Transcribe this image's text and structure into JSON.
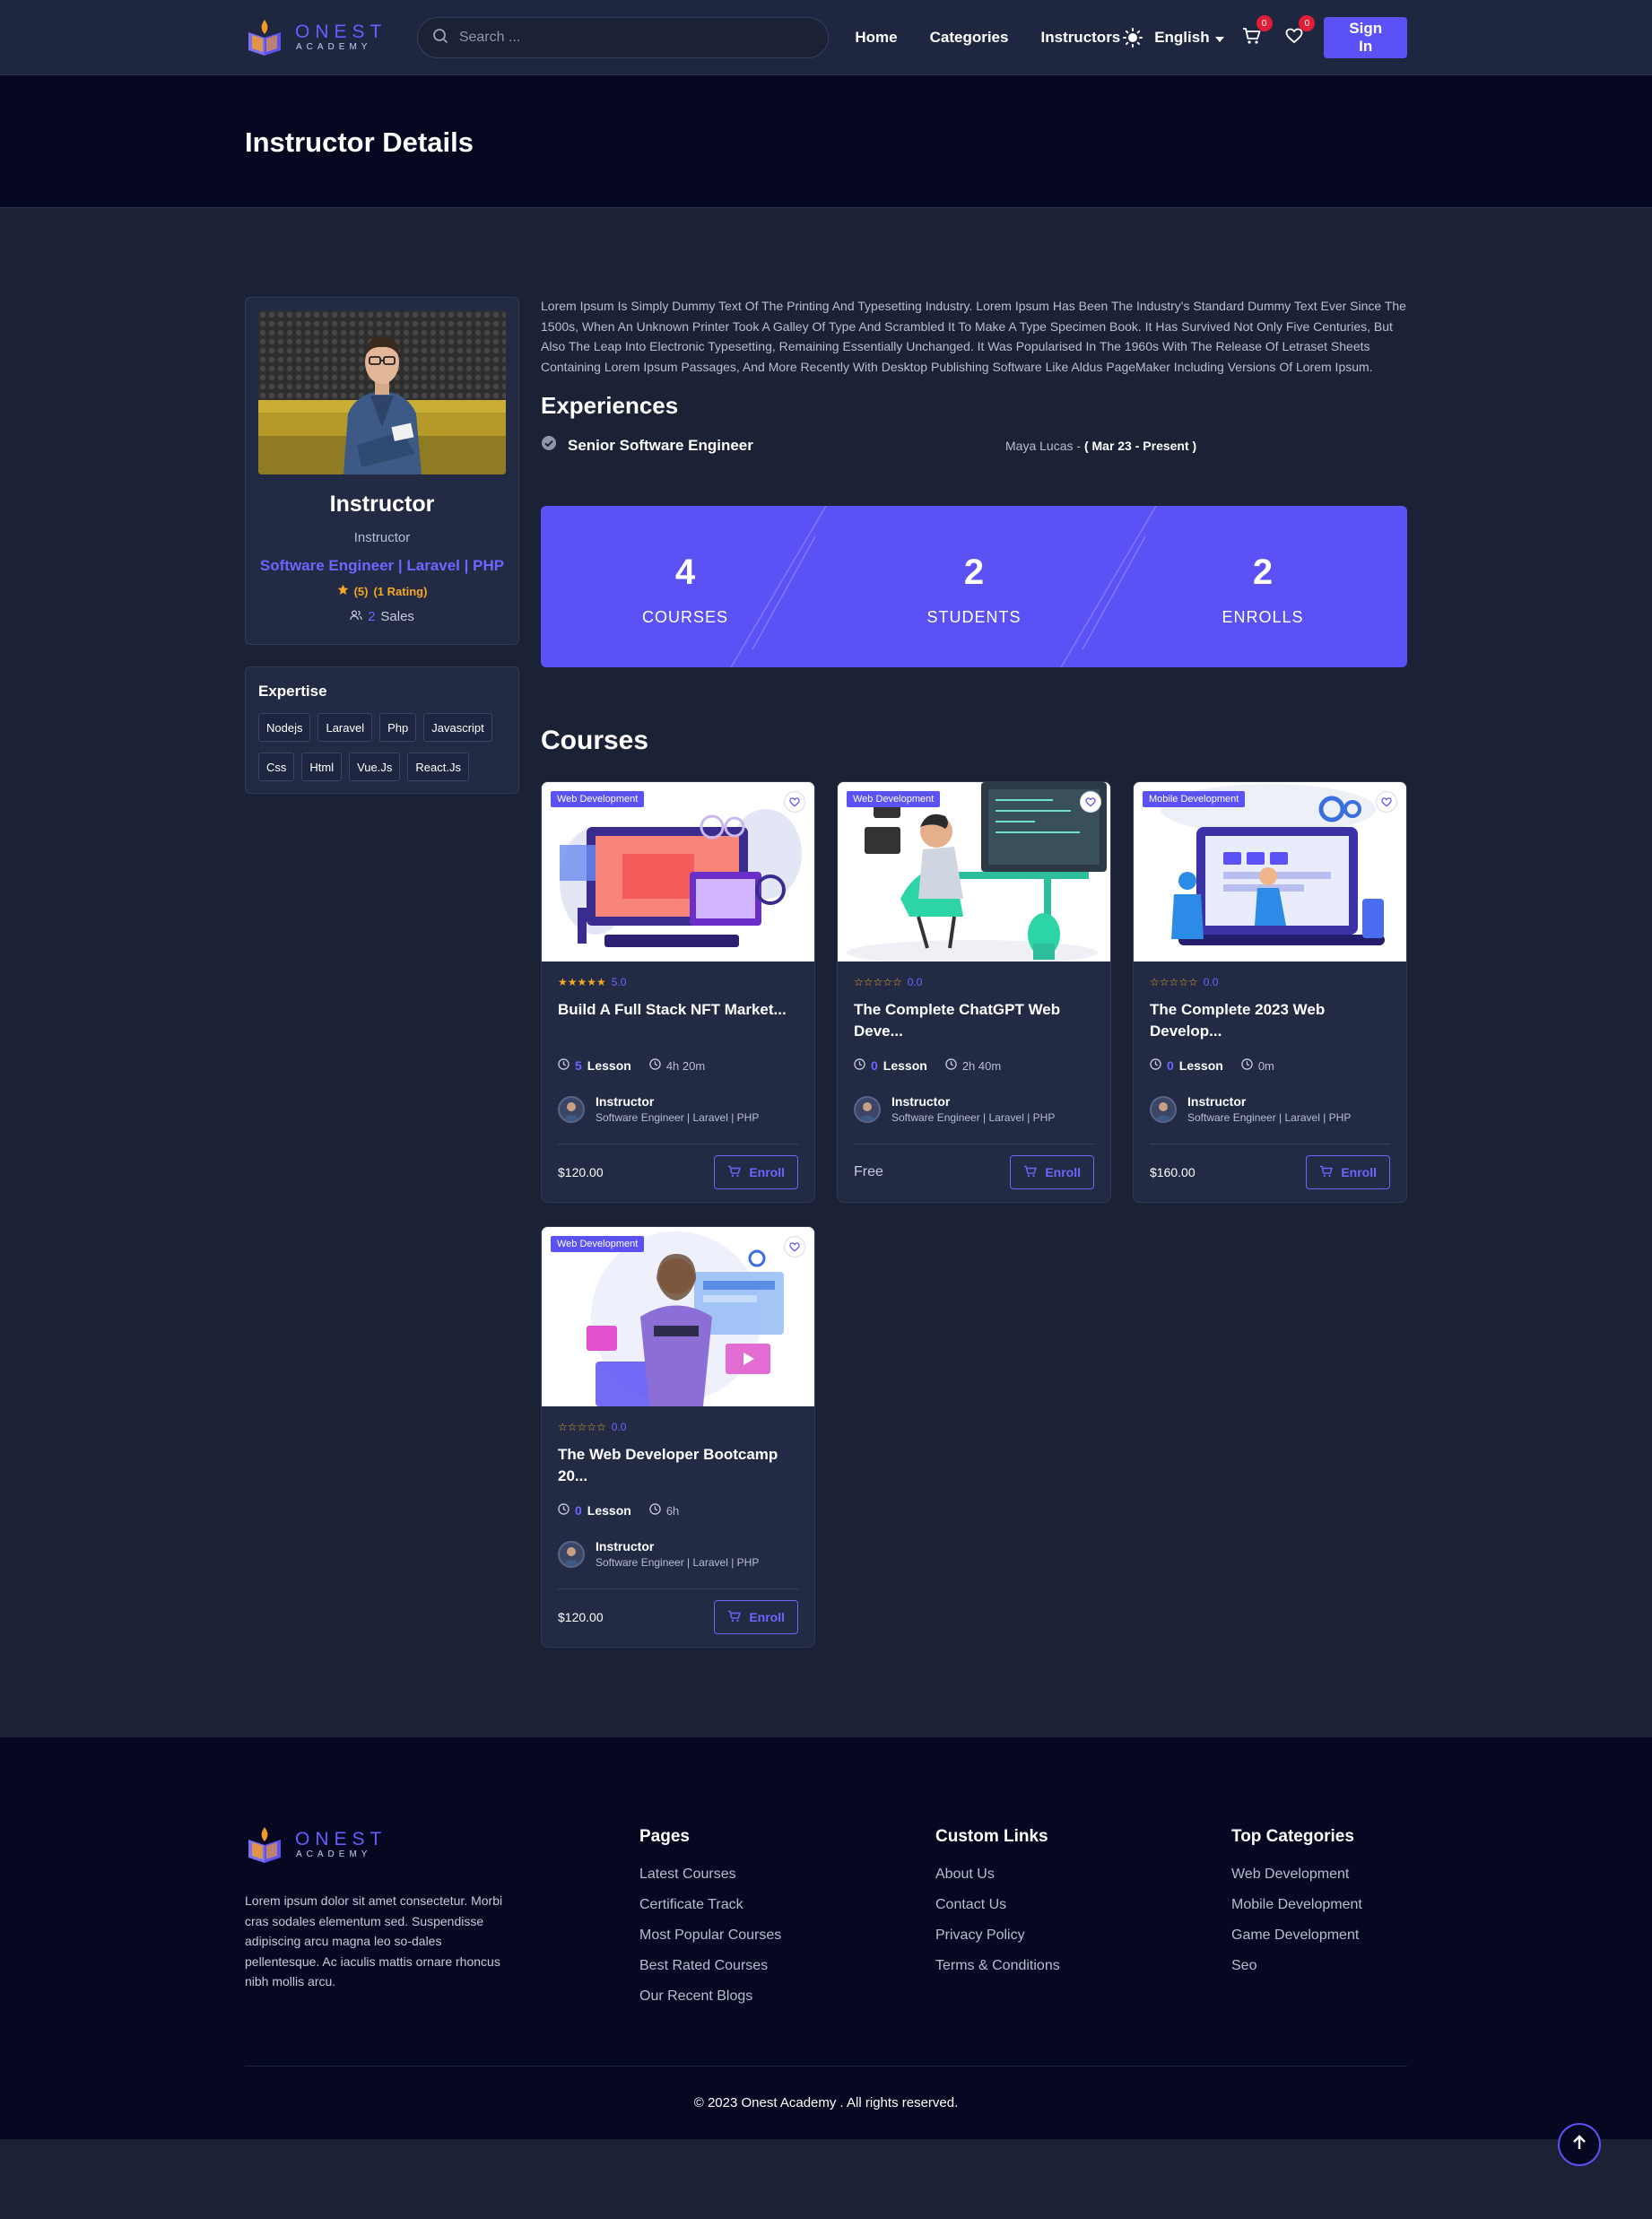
{
  "brand": {
    "name": "ONEST",
    "sub": "ACADEMY"
  },
  "header": {
    "search_placeholder": "Search ...",
    "nav": [
      "Home",
      "Categories",
      "Instructors"
    ],
    "language": "English",
    "cart_count": "0",
    "wishlist_count": "0",
    "sign_in": "Sign In"
  },
  "banner": {
    "title": "Instructor Details"
  },
  "profile": {
    "name": "Instructor",
    "role": "Instructor",
    "specialty": "Software Engineer | Laravel | PHP",
    "rating": "(5)",
    "rating_count": "(1 Rating)",
    "sales_count": "2",
    "sales_label": "Sales"
  },
  "expertise": {
    "title": "Expertise",
    "tags": [
      "Nodejs",
      "Laravel",
      "Php",
      "Javascript",
      "Css",
      "Html",
      "Vue.Js",
      "React.Js"
    ]
  },
  "bio": "Lorem Ipsum Is Simply Dummy Text Of The Printing And Typesetting Industry. Lorem Ipsum Has Been The Industry's Standard Dummy Text Ever Since The 1500s, When An Unknown Printer Took A Galley Of Type And Scrambled It To Make A Type Specimen Book. It Has Survived Not Only Five Centuries, But Also The Leap Into Electronic Typesetting, Remaining Essentially Unchanged. It Was Popularised In The 1960s With The Release Of Letraset Sheets Containing Lorem Ipsum Passages, And More Recently With Desktop Publishing Software Like Aldus PageMaker Including Versions Of Lorem Ipsum.",
  "experiences": {
    "title": "Experiences",
    "items": [
      {
        "title": "Senior Software Engineer",
        "company": "Maya Lucas - ",
        "period": "( Mar 23 - Present )"
      }
    ]
  },
  "stats": [
    {
      "value": "4",
      "label": "COURSES"
    },
    {
      "value": "2",
      "label": "STUDENTS"
    },
    {
      "value": "2",
      "label": "ENROLLS"
    }
  ],
  "courses": {
    "title": "Courses",
    "items": [
      {
        "category": "Web Development",
        "rating": "5.0",
        "stars": 5,
        "title": "Build A Full Stack NFT Market...",
        "lessons": "5",
        "lesson_label": "Lesson",
        "duration": "4h 20m",
        "instructor": "Instructor",
        "instructor_spec": "Software Engineer | Laravel | PHP",
        "price": "$120.00",
        "enroll": "Enroll"
      },
      {
        "category": "Web Development",
        "rating": "0.0",
        "stars": 0,
        "title": "The Complete ChatGPT Web Deve...",
        "lessons": "0",
        "lesson_label": "Lesson",
        "duration": "2h 40m",
        "instructor": "Instructor",
        "instructor_spec": "Software Engineer | Laravel | PHP",
        "price": "Free",
        "enroll": "Enroll"
      },
      {
        "category": "Mobile Development",
        "rating": "0.0",
        "stars": 0,
        "title": "The Complete 2023 Web Develop...",
        "lessons": "0",
        "lesson_label": "Lesson",
        "duration": "0m",
        "instructor": "Instructor",
        "instructor_spec": "Software Engineer | Laravel | PHP",
        "price": "$160.00",
        "enroll": "Enroll"
      },
      {
        "category": "Web Development",
        "rating": "0.0",
        "stars": 0,
        "title": "The Web Developer Bootcamp 20...",
        "lessons": "0",
        "lesson_label": "Lesson",
        "duration": "6h",
        "instructor": "Instructor",
        "instructor_spec": "Software Engineer | Laravel | PHP",
        "price": "$120.00",
        "enroll": "Enroll"
      }
    ]
  },
  "footer": {
    "about": "Lorem ipsum dolor sit amet consectetur. Morbi cras sodales elementum sed. Suspendisse adipiscing arcu magna leo so-dales pellentesque. Ac iaculis mattis ornare rhoncus nibh mollis arcu.",
    "pages": {
      "title": "Pages",
      "links": [
        "Latest Courses",
        "Certificate Track",
        "Most Popular Courses",
        "Best Rated Courses",
        "Our Recent Blogs"
      ]
    },
    "custom": {
      "title": "Custom Links",
      "links": [
        "About Us",
        "Contact Us",
        "Privacy Policy",
        "Terms & Conditions"
      ]
    },
    "categories": {
      "title": "Top Categories",
      "links": [
        "Web Development",
        "Mobile Development",
        "Game Development",
        "Seo"
      ]
    },
    "copyright": "© 2023 Onest Academy . All rights reserved."
  },
  "colors": {
    "accent": "#5b51f5",
    "bg": "#1b2236",
    "dark": "#050820",
    "star": "#f4a823",
    "badge": "#e01e37"
  }
}
